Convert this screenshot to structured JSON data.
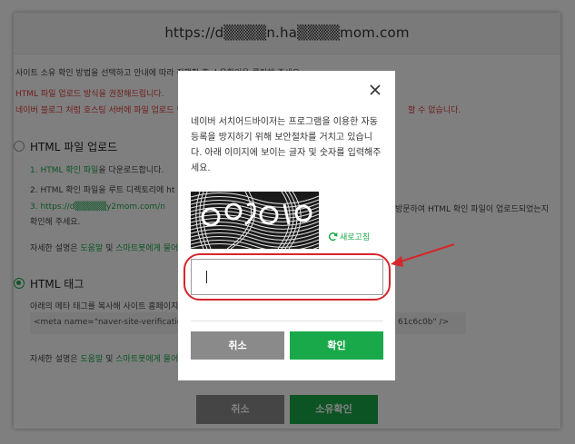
{
  "background": {
    "url": "https://d▒▒▒▒n.ha▒▒▒▒mom.com",
    "intro": "사이트 소유 확인 방법을 선택하고 안내에 따라 진행한 후 소유확인을 클릭해 주세요.",
    "recommend": "HTML 파일 업로드 방식을 권장해드립니다.",
    "warning": "네이버 블로그 처럼 호스팅 서버에 파일 업로드 할",
    "warning_tail": "할 수 없습니다.",
    "option_html_file": "HTML 파일 업로드",
    "step1": "1. HTML 확인 파일을 다운로드합니다.",
    "step2": "2. HTML 확인 파일을 루트 디렉토리에 ht",
    "step3": "3. https://d▒▒▒▒▒y2mom.com/n",
    "step3_tail": "방문하여 HTML 확인 파일이 업로드되었는지",
    "step3_line2": "확인해 주세요.",
    "help1": "자세한 설명은 도움말 및 스마트봇에게 물어",
    "option_html_tag": "HTML 태그",
    "tag_desc": "아래의 메타 태그를 복사해 사이트 홈페이지",
    "meta_tag": "<meta name=\"naver-site-verificatio",
    "meta_tag_tail": "61c6c0b\" />",
    "help2": "자세한 설명은 도움말 및 스마트봇에게 물어",
    "cancel": "취소",
    "verify": "소유확인"
  },
  "modal": {
    "description": "네이버 서치어드바이저는 프로그램을 이용한 자동등록을 방지하기 위해 보안절차를 거치고 있습니다. 아래 이미지에 보이는 글자 및 숫자를 입력해주세요.",
    "refresh_label": "새로고침",
    "input_value": "",
    "cancel_label": "취소",
    "confirm_label": "확인"
  },
  "colors": {
    "accent_green": "#1aa94a",
    "cancel_gray": "#8a8a8a",
    "annotation_red": "#d6262b"
  },
  "icons": {
    "close": "close-icon",
    "refresh": "refresh-icon"
  }
}
